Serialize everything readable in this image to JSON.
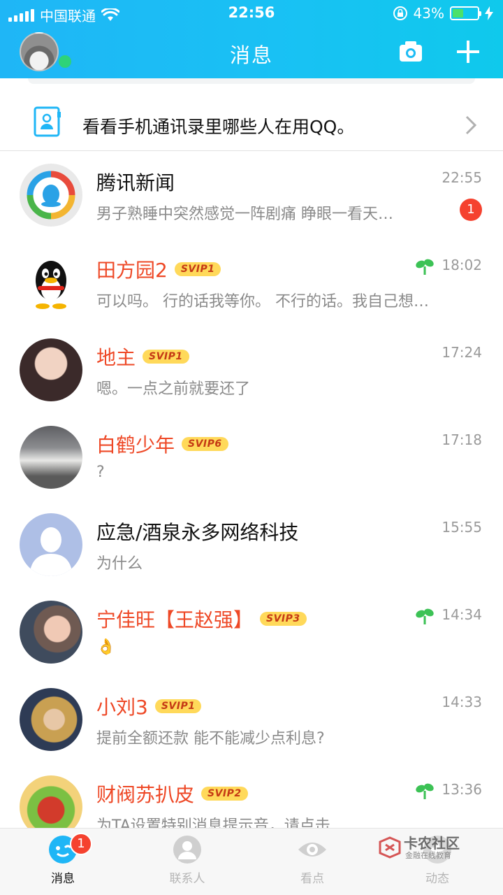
{
  "status_bar": {
    "carrier": "中国联通",
    "time": "22:56",
    "battery": "43%"
  },
  "nav": {
    "title": "消息"
  },
  "banner": {
    "text": "看看手机通讯录里哪些人在用QQ。"
  },
  "conversations": [
    {
      "name": "腾讯新闻",
      "vip": "",
      "time": "22:55",
      "preview": "男子熟睡中突然感觉一阵剧痛 睁眼一看天…",
      "unread": "1",
      "sprout": false
    },
    {
      "name": "田方园2",
      "vip": "SVIP1",
      "time": "18:02",
      "preview": "可以吗。 行的话我等你。 不行的话。我自己想…",
      "unread": "",
      "sprout": true
    },
    {
      "name": "地主",
      "vip": "SVIP1",
      "time": "17:24",
      "preview": "嗯。一点之前就要还了",
      "unread": "",
      "sprout": false
    },
    {
      "name": "白鹤少年",
      "vip": "SVIP6",
      "time": "17:18",
      "preview": "?",
      "unread": "",
      "sprout": false
    },
    {
      "name": "应急/酒泉永多网络科技",
      "vip": "",
      "time": "15:55",
      "preview": "为什么",
      "unread": "",
      "sprout": false
    },
    {
      "name": "宁佳旺【王赵强】",
      "vip": "SVIP3",
      "time": "14:34",
      "preview": "👌",
      "unread": "",
      "sprout": true
    },
    {
      "name": "小刘3",
      "vip": "SVIP1",
      "time": "14:33",
      "preview": "提前全额还款 能不能减少点利息?",
      "unread": "",
      "sprout": false
    },
    {
      "name": "财阀苏扒皮",
      "vip": "SVIP2",
      "time": "13:36",
      "preview": "为TA设置特别消息提示音，请点击",
      "unread": "",
      "sprout": true
    }
  ],
  "tabs": [
    {
      "label": "消息",
      "badge": "1",
      "icon": "chat-bubble-icon"
    },
    {
      "label": "联系人",
      "badge": "",
      "icon": "person-icon"
    },
    {
      "label": "看点",
      "badge": "",
      "icon": "eye-icon"
    },
    {
      "label": "动态",
      "badge": "",
      "icon": "star-icon"
    }
  ],
  "watermark": {
    "title": "卡农社区",
    "subtitle": "金融在线教育"
  },
  "colors": {
    "header": "#1fb6f6",
    "vip_name": "#ee4826",
    "badge": "#f5422f"
  }
}
